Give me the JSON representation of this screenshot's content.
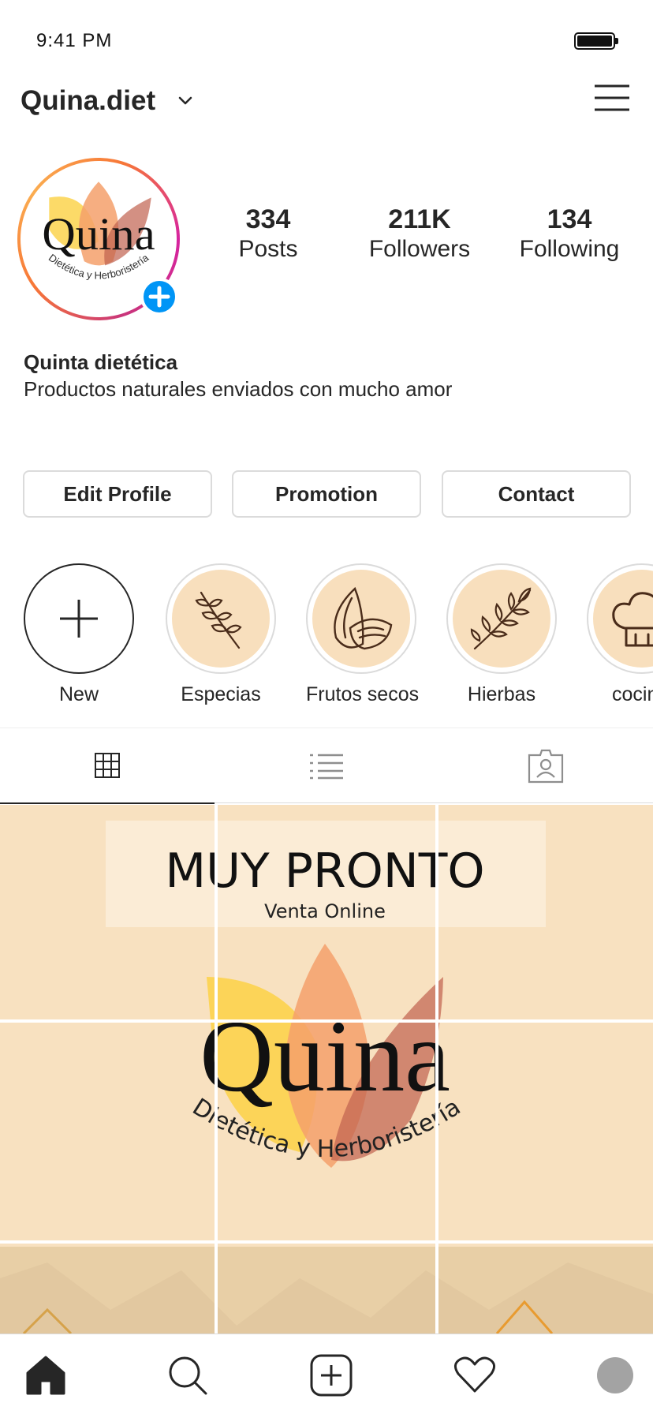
{
  "status_bar": {
    "time": "9:41 PM"
  },
  "header": {
    "username": "Quina.diet"
  },
  "avatar": {
    "logo_text": "Quina",
    "logo_subtitle": "Dietética y Herboristería"
  },
  "stats": [
    {
      "value": "334",
      "label": "Posts"
    },
    {
      "value": "211K",
      "label": "Followers"
    },
    {
      "value": "134",
      "label": "Following"
    }
  ],
  "bio": {
    "name": "Quinta dietética",
    "text": "Productos naturales enviados con mucho amor"
  },
  "buttons": {
    "edit_profile": "Edit Profile",
    "promotion": "Promotion",
    "contact": "Contact"
  },
  "highlights": [
    {
      "label": "New",
      "icon": "plus-icon"
    },
    {
      "label": "Especias",
      "icon": "wheat-icon"
    },
    {
      "label": "Frutos secos",
      "icon": "almond-icon"
    },
    {
      "label": "Hierbas",
      "icon": "herb-branch-icon"
    },
    {
      "label": "cocin",
      "icon": "chef-hat-icon"
    }
  ],
  "tabs": [
    {
      "name": "grid",
      "icon": "grid-icon",
      "active": true
    },
    {
      "name": "list",
      "icon": "list-icon",
      "active": false
    },
    {
      "name": "tagged",
      "icon": "tagged-person-icon",
      "active": false
    }
  ],
  "post_banner": {
    "title": "MUY PRONTO",
    "subtitle": "Venta Online",
    "logo_text": "Quina",
    "logo_subtitle": "Dietética y Herboristería"
  },
  "bottom_nav": [
    {
      "name": "home",
      "icon": "home-icon"
    },
    {
      "name": "search",
      "icon": "search-icon"
    },
    {
      "name": "new-post",
      "icon": "add-post-icon"
    },
    {
      "name": "activity",
      "icon": "heart-icon"
    },
    {
      "name": "profile",
      "icon": "profile-avatar-icon"
    }
  ],
  "colors": {
    "accent_blue": "#0095f6",
    "story_ring": [
      "#d6249f",
      "#f77737",
      "#fbad50"
    ],
    "highlight_fill": "#f8dfbd",
    "post_bg": "#f8e1c0",
    "leaf_yellow": "#fcd34d",
    "leaf_orange": "#f4a06b",
    "leaf_red": "#c0614f"
  }
}
